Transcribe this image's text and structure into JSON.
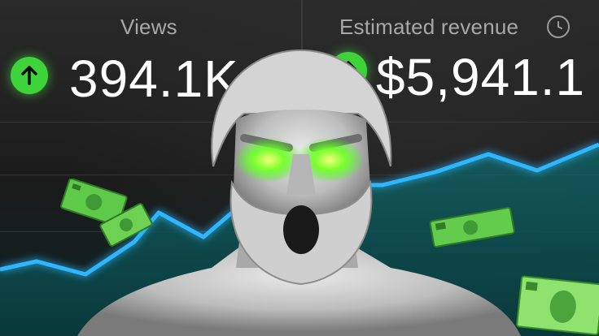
{
  "cards": [
    {
      "label": "Views",
      "value": "394.1K",
      "trend": "up"
    },
    {
      "label": "Estimated revenue",
      "value": "$5,941.1",
      "trend": "up"
    }
  ],
  "icons": {
    "trend": "arrow-up-icon",
    "info": "clock-icon"
  },
  "colors": {
    "accent_green": "#3fd33a",
    "line_blue": "#2fb7ff",
    "fill_teal": "#0c4c4f",
    "eye_green": "#6dff3a"
  }
}
